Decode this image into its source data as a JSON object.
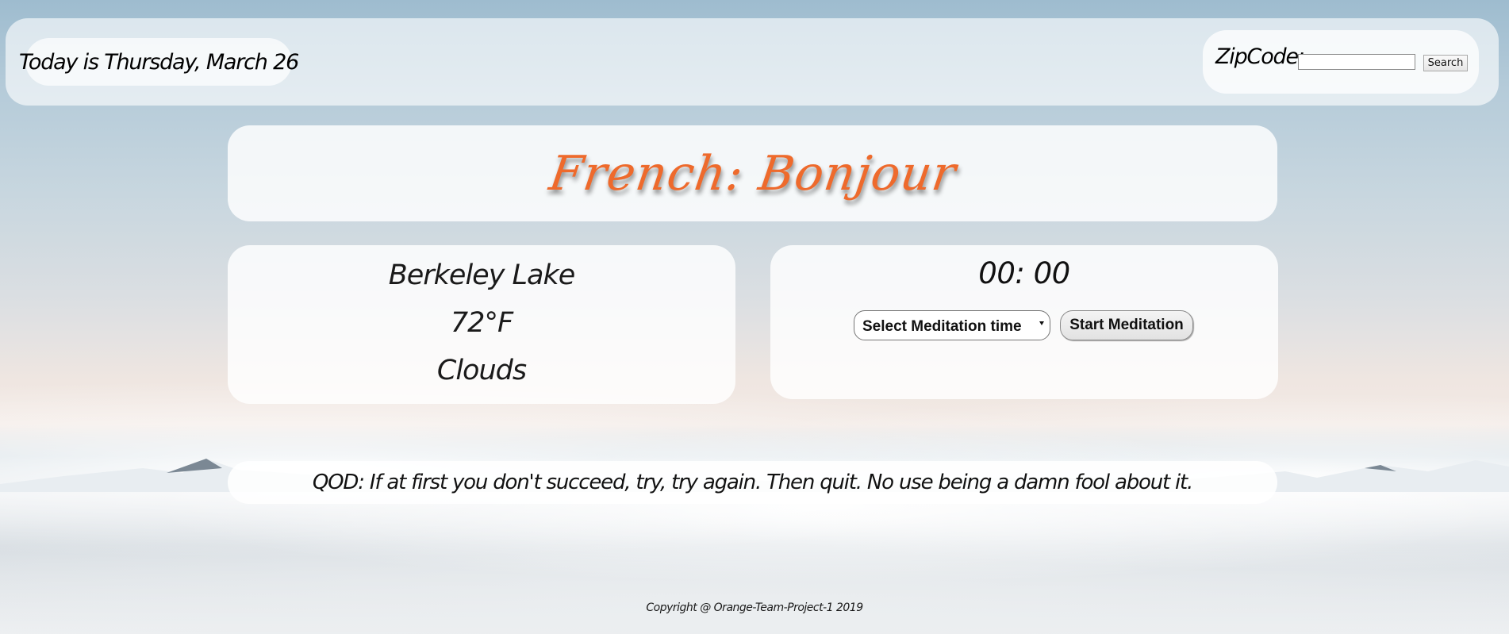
{
  "header": {
    "date_text": "Today is Thursday, March 26",
    "zip_label": "ZipCode:",
    "zip_input_value": "",
    "search_label": "Search"
  },
  "greeting": {
    "text": "French: Bonjour"
  },
  "weather": {
    "city": "Berkeley Lake",
    "temperature": "72°F",
    "condition": "Clouds"
  },
  "meditation": {
    "timer": "00: 00",
    "select_label": "Select Meditation time",
    "start_label": "Start Meditation"
  },
  "quote": {
    "text": "QOD: If at first you don't succeed, try, try again. Then quit. No use being a damn fool about it."
  },
  "footer": {
    "text": "Copyright @ Orange-Team-Project-1 2019"
  },
  "colors": {
    "greeting": "#ee6a2c",
    "panel": "#ffffff"
  }
}
